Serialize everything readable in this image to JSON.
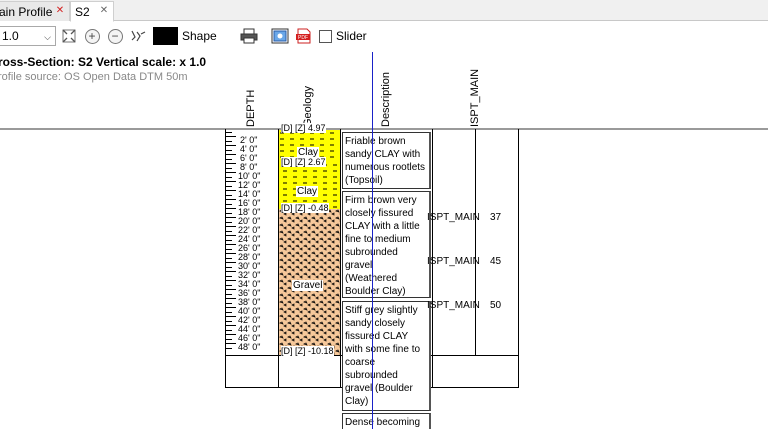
{
  "tabs": [
    {
      "label": "ain Profile",
      "close": "✕"
    },
    {
      "label": "S2",
      "close": "✕"
    }
  ],
  "toolbar": {
    "scale_value": "1.0",
    "shape_label": "Shape",
    "slider_label": "Slider",
    "swatch_color": "#000000",
    "icons": [
      "zoom-fit-icon",
      "zoom-in-icon",
      "zoom-out-icon",
      "pointer-icon",
      "print-icon",
      "export-image-icon",
      "export-pdf-icon"
    ]
  },
  "header": {
    "title": "ross-Section: S2   Vertical scale: x 1.0",
    "source": "rofile source: OS Open Data DTM 50m"
  },
  "columns": {
    "depth": "DEPTH",
    "geology": "Geology",
    "description": "Description",
    "ispt": "ISPT_MAIN"
  },
  "depth_labels": [
    "2' 0\"",
    "4' 0\"",
    "6' 0\"",
    "8' 0\"",
    "10' 0\"",
    "12' 0\"",
    "14' 0\"",
    "16' 0\"",
    "18' 0\"",
    "20' 0\"",
    "22' 0\"",
    "24' 0\"",
    "26' 0\"",
    "28' 0\"",
    "30' 0\"",
    "32' 0\"",
    "34' 0\"",
    "36' 0\"",
    "38' 0\"",
    "40' 0\"",
    "42' 0\"",
    "44' 0\"",
    "46' 0\"",
    "48' 0\""
  ],
  "geology": {
    "layers": [
      {
        "label": "Clay",
        "color": "#ffff00"
      },
      {
        "label": "Clay",
        "color": "#ffff00"
      },
      {
        "label": "Gravel",
        "color": "#f6c89a"
      }
    ],
    "levels": [
      "[D] [Z] 4.97",
      "[D] [Z] 2.67",
      "[D] [Z] -0.48",
      "[D] [Z] -10.18"
    ]
  },
  "descriptions": [
    "Friable brown sandy CLAY with numerous rootlets (Topsoil)",
    "Firm brown very closely fissured CLAY with a little fine to medium subrounded gravel (Weathered Boulder Clay)",
    "Stiff grey slightly sandy closely fissured CLAY with some fine to coarse subrounded gravel (Boulder Clay)",
    "Dense becoming"
  ],
  "ispt": [
    {
      "label": "ISPT_MAIN",
      "value": "37"
    },
    {
      "label": "ISPT_MAIN",
      "value": "45"
    },
    {
      "label": "ISPT_MAIN",
      "value": "50"
    }
  ],
  "cursor_color": "#1a22c8"
}
